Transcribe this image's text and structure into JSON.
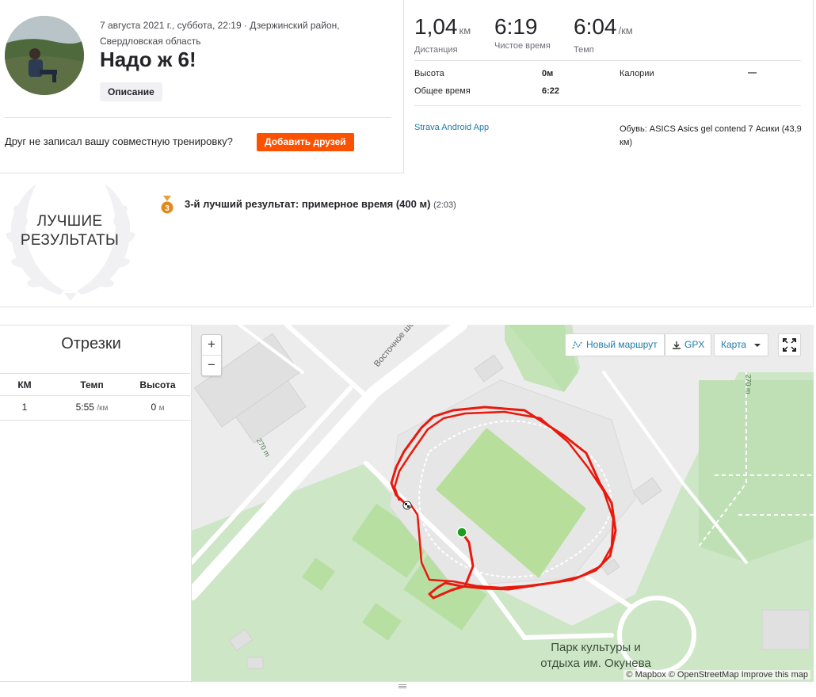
{
  "activity": {
    "date_location": "7 августа 2021 г., суббота, 22:19 · Дзержинский район, Свердловская область",
    "title": "Надо ж 6!",
    "description_button": "Описание",
    "friend_prompt": "Друг не записал вашу совместную тренировку?",
    "add_friends_button": "Добавить друзей"
  },
  "stats": {
    "distance": {
      "value": "1,04",
      "unit": "км",
      "label": "Дистанция"
    },
    "moving_time": {
      "value": "6:19",
      "label": "Чистое время"
    },
    "pace": {
      "value": "6:04",
      "unit": "/км",
      "label": "Темп"
    },
    "elevation": {
      "label": "Высота",
      "value": "0м"
    },
    "elapsed": {
      "label": "Общее время",
      "value": "6:22"
    },
    "calories": {
      "label": "Калории",
      "value": "—"
    },
    "device": "Strava Android App",
    "shoes": "Обувь: ASICS Asics gel contend 7 Асики (43,9 км)"
  },
  "best_efforts": {
    "badge_label": "ЛУЧШИЕ РЕЗУЛЬТАТЫ",
    "medal_rank": "3",
    "item_text": "3-й лучший результат: примерное время (400 м)",
    "item_time": "(2:03)"
  },
  "splits": {
    "title": "Отрезки",
    "headers": [
      "КМ",
      "Темп",
      "Высота"
    ],
    "rows": [
      {
        "km": "1",
        "pace": "5:55",
        "pace_unit": "/км",
        "elev": "0",
        "elev_unit": "м"
      }
    ]
  },
  "map": {
    "zoom_in": "+",
    "zoom_out": "−",
    "new_route": "Новый маршрут",
    "gpx": "GPX",
    "map_type": "Карта",
    "attribution": "© Mapbox © OpenStreetMap Improve this map",
    "park_label": "Парк культуры и отдыха им. Окунева",
    "road_label": "Восточное шоссе",
    "distance_label_1": "270 m",
    "distance_label_2": "270 m",
    "route_color": "#e8190d",
    "start_color": "#18a018"
  }
}
